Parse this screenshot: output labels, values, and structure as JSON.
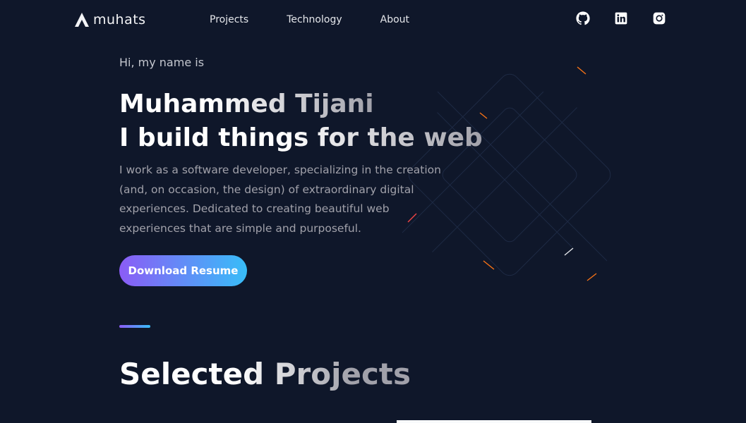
{
  "brand": {
    "name": "muhats",
    "logo_icon": "triangle-logo-icon"
  },
  "nav": {
    "items": [
      {
        "label": "Projects"
      },
      {
        "label": "Technology"
      },
      {
        "label": "About"
      }
    ]
  },
  "social": {
    "items": [
      {
        "icon": "github-icon"
      },
      {
        "icon": "linkedin-icon"
      },
      {
        "icon": "instagram-icon"
      }
    ]
  },
  "hero": {
    "greeting": "Hi, my name is",
    "name": "Muhammed Tijani",
    "tagline": "I build things for the web",
    "description": "I work as a software developer, specializing in the creation (and, on occasion, the design) of extraordinary digital experiences. Dedicated to creating beautiful web experiences that are simple and purposeful.",
    "cta_label": "Download Resume"
  },
  "projects": {
    "title": "Selected Projects"
  },
  "colors": {
    "background": "#0f172a",
    "gradient_start": "#8b5cf6",
    "gradient_end": "#38bdf8",
    "text_primary": "#ffffff",
    "text_muted": "#a1a1aa"
  }
}
